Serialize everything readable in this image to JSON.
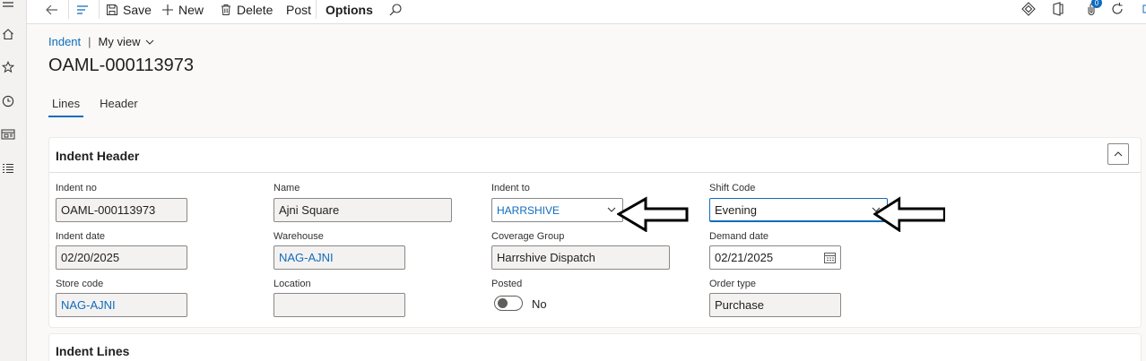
{
  "toolbar": {
    "save_label": "Save",
    "new_label": "New",
    "delete_label": "Delete",
    "post_label": "Post",
    "options_label": "Options",
    "notification_count": "0"
  },
  "breadcrumb": {
    "module": "Indent",
    "separator": "|",
    "view": "My view"
  },
  "page_title": "OAML-000113973",
  "tabs": [
    {
      "label": "Lines"
    },
    {
      "label": "Header"
    }
  ],
  "header_card": {
    "title": "Indent Header",
    "fields": {
      "indent_no": {
        "label": "Indent no",
        "value": "OAML-000113973"
      },
      "name": {
        "label": "Name",
        "value": "Ajni Square"
      },
      "indent_to": {
        "label": "Indent to",
        "value": "HARRSHIVE"
      },
      "shift_code": {
        "label": "Shift Code",
        "value": "Evening"
      },
      "indent_date": {
        "label": "Indent date",
        "value": "02/20/2025"
      },
      "warehouse": {
        "label": "Warehouse",
        "value": "NAG-AJNI"
      },
      "coverage_group": {
        "label": "Coverage Group",
        "value": "Harrshive Dispatch"
      },
      "demand_date": {
        "label": "Demand date",
        "value": "02/21/2025"
      },
      "store_code": {
        "label": "Store code",
        "value": "NAG-AJNI"
      },
      "location": {
        "label": "Location",
        "value": ""
      },
      "posted": {
        "label": "Posted",
        "value": "No"
      },
      "order_type": {
        "label": "Order type",
        "value": "Purchase"
      }
    }
  },
  "lines_card": {
    "title": "Indent Lines"
  },
  "colors": {
    "accent": "#0f6cbd",
    "link": "#0f6cbd",
    "badge": "#0f6cbd"
  }
}
